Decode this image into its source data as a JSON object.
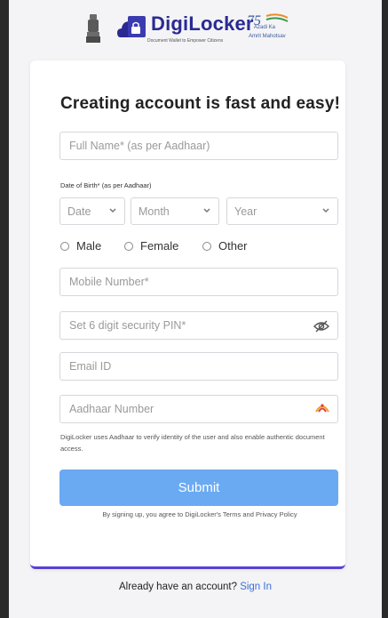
{
  "header": {
    "brand_name": "DigiLocker",
    "brand_tagline": "Document Wallet to Empower Citizens",
    "azadi_line1": "Azadi Ka",
    "azadi_line2": "Amrit Mahotsav"
  },
  "form": {
    "title": "Creating account is fast and easy!",
    "full_name_placeholder": "Full Name* (as per Aadhaar)",
    "dob_label": "Date of Birth* (as per Aadhaar)",
    "dob_date": "Date",
    "dob_month": "Month",
    "dob_year": "Year",
    "gender_options": [
      "Male",
      "Female",
      "Other"
    ],
    "mobile_placeholder": "Mobile Number*",
    "pin_placeholder": "Set 6 digit security PIN*",
    "email_placeholder": "Email ID",
    "aadhaar_placeholder": "Aadhaar Number",
    "aadhaar_help": "DigiLocker uses Aadhaar to verify identity of the user and also enable authentic document access.",
    "submit_label": "Submit",
    "terms_text": "By signing up, you agree to DigiLocker's Terms and Privacy Policy"
  },
  "footer": {
    "already_text": "Already have an account?",
    "sign_in_label": "Sign In"
  },
  "colors": {
    "brand": "#2a2a92",
    "submit": "#6aaaf2",
    "accent_border": "#5b3fd6",
    "link": "#3a6fd8"
  }
}
